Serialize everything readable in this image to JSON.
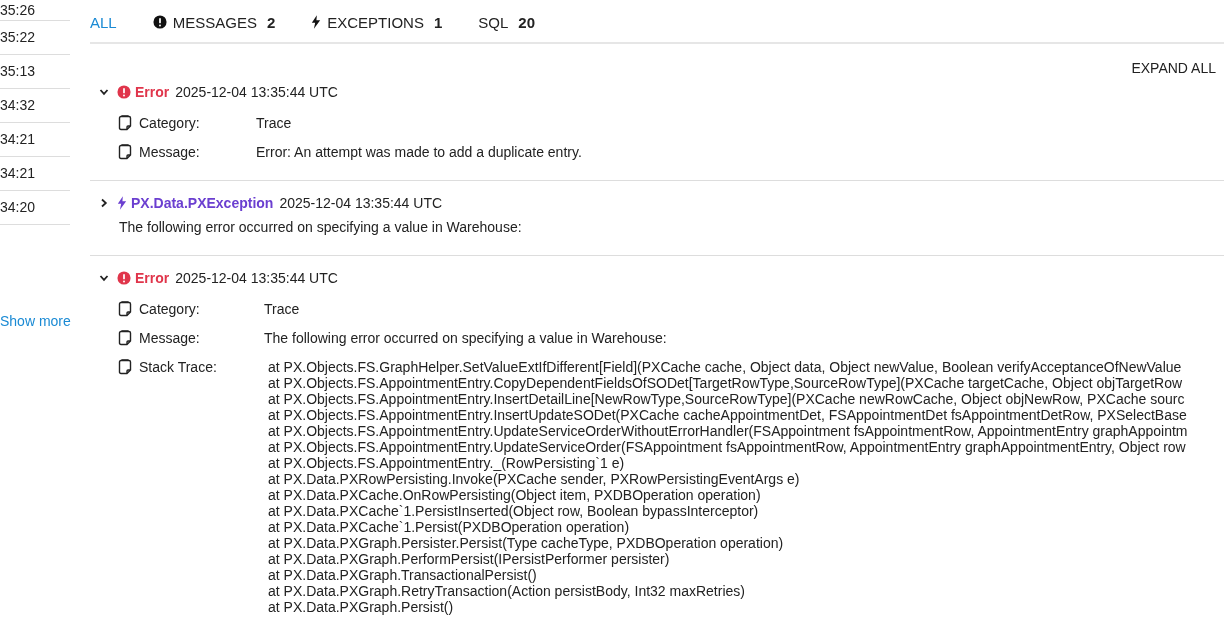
{
  "sidebar": {
    "times": [
      "35:26",
      "35:22",
      "35:13",
      "34:32",
      "34:21",
      "34:21",
      "34:20"
    ],
    "show_more": "Show more"
  },
  "tabs": [
    {
      "kind": "all",
      "label": "ALL",
      "selected": true
    },
    {
      "kind": "messages",
      "label": "MESSAGES",
      "count": "2",
      "selected": false
    },
    {
      "kind": "exceptions",
      "label": "EXCEPTIONS",
      "count": "1",
      "selected": false
    },
    {
      "kind": "sql",
      "label": "SQL",
      "count": "20",
      "selected": false
    }
  ],
  "expand_all": "EXPAND ALL",
  "entries": [
    {
      "kind": "error",
      "expanded": true,
      "title": "Error",
      "time": "2025-12-04 13:35:44 UTC",
      "fields": [
        {
          "label": "Category:",
          "value": "Trace"
        },
        {
          "label": "Message:",
          "value": "Error: An attempt was made to add a duplicate entry."
        }
      ]
    },
    {
      "kind": "exception",
      "expanded": false,
      "title": "PX.Data.PXException",
      "time": "2025-12-04 13:35:44 UTC",
      "summary": "The following error occurred on specifying a value in Warehouse:"
    },
    {
      "kind": "error",
      "expanded": true,
      "title": "Error",
      "time": "2025-12-04 13:35:44 UTC",
      "fields": [
        {
          "label": "Category:",
          "value": "Trace"
        },
        {
          "label": "Message:",
          "value": "The following error occurred on specifying a value in Warehouse:"
        },
        {
          "label": "Stack Trace:",
          "lines": [
            "at PX.Objects.FS.GraphHelper.SetValueExtIfDifferent[Field](PXCache cache, Object data, Object newValue, Boolean verifyAcceptanceOfNewValue",
            "at PX.Objects.FS.AppointmentEntry.CopyDependentFieldsOfSODet[TargetRowType,SourceRowType](PXCache targetCache, Object objTargetRow",
            "at PX.Objects.FS.AppointmentEntry.InsertDetailLine[NewRowType,SourceRowType](PXCache newRowCache, Object objNewRow, PXCache sourc",
            "at PX.Objects.FS.AppointmentEntry.InsertUpdateSODet(PXCache cacheAppointmentDet, FSAppointmentDet fsAppointmentDetRow, PXSelectBase",
            "at PX.Objects.FS.AppointmentEntry.UpdateServiceOrderWithoutErrorHandler(FSAppointment fsAppointmentRow, AppointmentEntry graphAppointm",
            "at PX.Objects.FS.AppointmentEntry.UpdateServiceOrder(FSAppointment fsAppointmentRow, AppointmentEntry graphAppointmentEntry, Object row",
            "at PX.Objects.FS.AppointmentEntry._(RowPersisting`1 e)",
            "at PX.Data.PXRowPersisting.Invoke(PXCache sender, PXRowPersistingEventArgs e)",
            "at PX.Data.PXCache.OnRowPersisting(Object item, PXDBOperation operation)",
            "at PX.Data.PXCache`1.PersistInserted(Object row, Boolean bypassInterceptor)",
            "at PX.Data.PXCache`1.Persist(PXDBOperation operation)",
            "at PX.Data.PXGraph.Persister.Persist(Type cacheType, PXDBOperation operation)",
            "at PX.Data.PXGraph.PerformPersist(IPersistPerformer persister)",
            "at PX.Data.PXGraph.TransactionalPersist()",
            "at PX.Data.PXGraph.RetryTransaction(Action persistBody, Int32 maxRetries)",
            "at PX.Data.PXGraph.Persist()"
          ]
        }
      ]
    }
  ]
}
